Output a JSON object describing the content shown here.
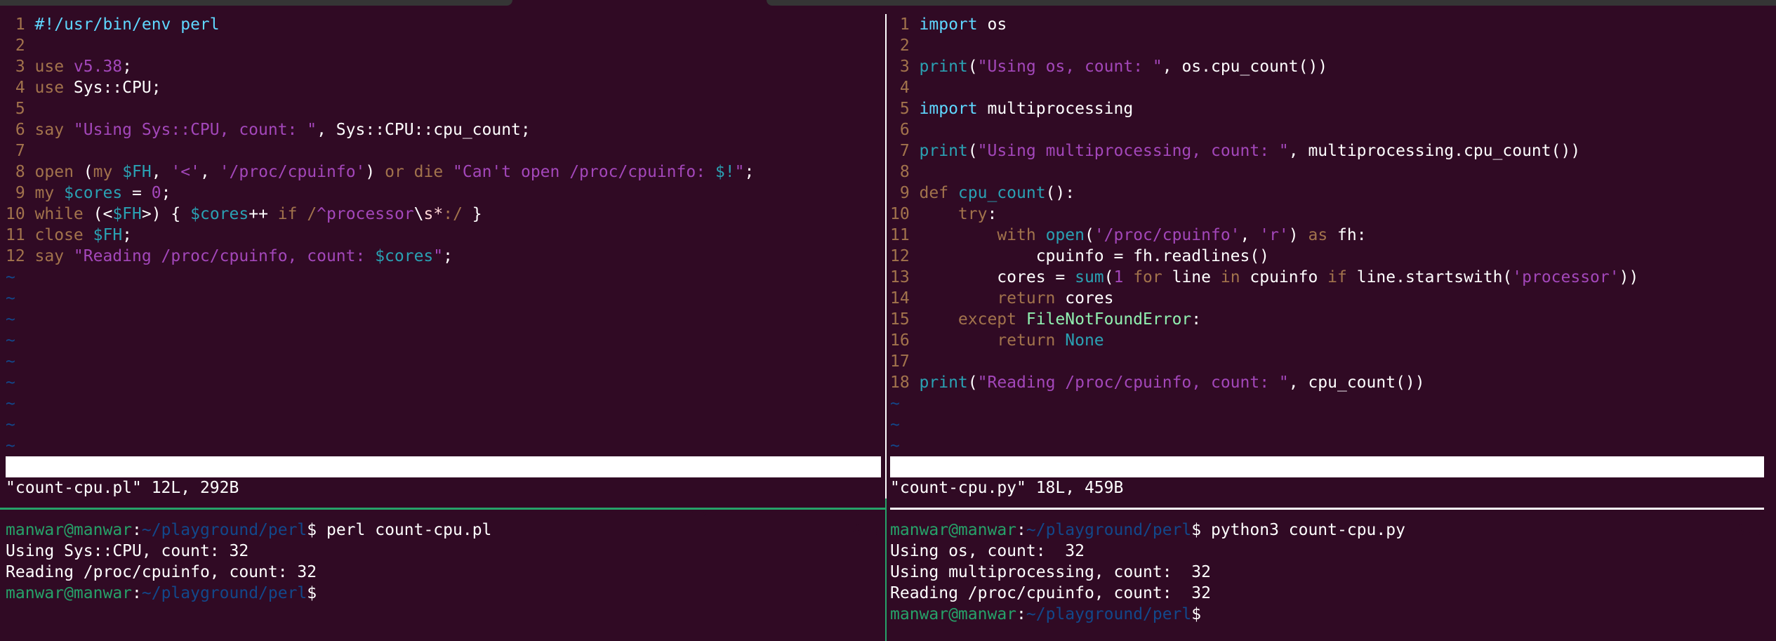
{
  "colors": {
    "background": "#300a24",
    "line_number": "#a2734c",
    "keyword": "#a2734c",
    "string": "#a347ba",
    "builtin": "#2aa1b3",
    "preproc": "#5fd7ff",
    "exception": "#90f0b0",
    "tilde": "#12488b",
    "prompt_user": "#26a269",
    "prompt_path": "#12488b"
  },
  "left_editor": {
    "filename": "count-cpu.pl",
    "cursor_pos": "1,1",
    "scroll": "All",
    "message": "\"count-cpu.pl\" 12L, 292B",
    "tilde_count": 9,
    "lines": [
      {
        "n": "1",
        "tokens": [
          {
            "t": "#!/usr/bin/env perl",
            "c": "cyan"
          }
        ]
      },
      {
        "n": "2",
        "tokens": []
      },
      {
        "n": "3",
        "tokens": [
          {
            "t": "use ",
            "c": "brown"
          },
          {
            "t": "v5.38",
            "c": "purple"
          },
          {
            "t": ";",
            "c": "white"
          }
        ]
      },
      {
        "n": "4",
        "tokens": [
          {
            "t": "use ",
            "c": "brown"
          },
          {
            "t": "Sys::CPU;",
            "c": "white"
          }
        ]
      },
      {
        "n": "5",
        "tokens": []
      },
      {
        "n": "6",
        "tokens": [
          {
            "t": "say ",
            "c": "brown"
          },
          {
            "t": "\"Using Sys::CPU, count: \"",
            "c": "purple"
          },
          {
            "t": ", Sys::CPU::cpu_count;",
            "c": "white"
          }
        ]
      },
      {
        "n": "7",
        "tokens": []
      },
      {
        "n": "8",
        "tokens": [
          {
            "t": "open ",
            "c": "brown"
          },
          {
            "t": "(",
            "c": "white"
          },
          {
            "t": "my ",
            "c": "brown"
          },
          {
            "t": "$FH",
            "c": "teal"
          },
          {
            "t": ", ",
            "c": "white"
          },
          {
            "t": "'<'",
            "c": "purple"
          },
          {
            "t": ", ",
            "c": "white"
          },
          {
            "t": "'/proc/cpuinfo'",
            "c": "purple"
          },
          {
            "t": ") ",
            "c": "white"
          },
          {
            "t": "or ",
            "c": "brown"
          },
          {
            "t": "die ",
            "c": "brown"
          },
          {
            "t": "\"Can't open /proc/cpuinfo: ",
            "c": "purple"
          },
          {
            "t": "$!",
            "c": "teal"
          },
          {
            "t": "\"",
            "c": "purple"
          },
          {
            "t": ";",
            "c": "white"
          }
        ]
      },
      {
        "n": "9",
        "tokens": [
          {
            "t": "my ",
            "c": "brown"
          },
          {
            "t": "$cores",
            "c": "teal"
          },
          {
            "t": " = ",
            "c": "white"
          },
          {
            "t": "0",
            "c": "purple"
          },
          {
            "t": ";",
            "c": "white"
          }
        ]
      },
      {
        "n": "10",
        "tokens": [
          {
            "t": "while ",
            "c": "brown"
          },
          {
            "t": "(<",
            "c": "white"
          },
          {
            "t": "$FH",
            "c": "teal"
          },
          {
            "t": ">) { ",
            "c": "white"
          },
          {
            "t": "$cores",
            "c": "teal"
          },
          {
            "t": "++ ",
            "c": "white"
          },
          {
            "t": "if ",
            "c": "brown"
          },
          {
            "t": "/",
            "c": "brown"
          },
          {
            "t": "^processor",
            "c": "purple"
          },
          {
            "t": "\\",
            "c": "white"
          },
          {
            "t": "s*",
            "c": "pink"
          },
          {
            "t": ":/",
            "c": "brown"
          },
          {
            "t": " }",
            "c": "white"
          }
        ]
      },
      {
        "n": "11",
        "tokens": [
          {
            "t": "close ",
            "c": "brown"
          },
          {
            "t": "$FH",
            "c": "teal"
          },
          {
            "t": ";",
            "c": "white"
          }
        ]
      },
      {
        "n": "12",
        "tokens": [
          {
            "t": "say ",
            "c": "brown"
          },
          {
            "t": "\"Reading /proc/cpuinfo, count: ",
            "c": "purple"
          },
          {
            "t": "$cores",
            "c": "teal"
          },
          {
            "t": "\"",
            "c": "purple"
          },
          {
            "t": ";",
            "c": "white"
          }
        ]
      }
    ]
  },
  "right_editor": {
    "filename": "count-cpu.py",
    "cursor_pos": "1,1",
    "scroll": "All",
    "message": "\"count-cpu.py\" 18L, 459B",
    "tilde_count": 3,
    "lines": [
      {
        "n": "1",
        "tokens": [
          {
            "t": "import ",
            "c": "cyan"
          },
          {
            "t": "os",
            "c": "white"
          }
        ]
      },
      {
        "n": "2",
        "tokens": []
      },
      {
        "n": "3",
        "tokens": [
          {
            "t": "print",
            "c": "teal"
          },
          {
            "t": "(",
            "c": "white"
          },
          {
            "t": "\"Using os, count: \"",
            "c": "purple"
          },
          {
            "t": ", os.cpu_count())",
            "c": "white"
          }
        ]
      },
      {
        "n": "4",
        "tokens": []
      },
      {
        "n": "5",
        "tokens": [
          {
            "t": "import ",
            "c": "cyan"
          },
          {
            "t": "multiprocessing",
            "c": "white"
          }
        ]
      },
      {
        "n": "6",
        "tokens": []
      },
      {
        "n": "7",
        "tokens": [
          {
            "t": "print",
            "c": "teal"
          },
          {
            "t": "(",
            "c": "white"
          },
          {
            "t": "\"Using multiprocessing, count: \"",
            "c": "purple"
          },
          {
            "t": ", multiprocessing.cpu_count())",
            "c": "white"
          }
        ]
      },
      {
        "n": "8",
        "tokens": []
      },
      {
        "n": "9",
        "tokens": [
          {
            "t": "def ",
            "c": "brown"
          },
          {
            "t": "cpu_count",
            "c": "teal"
          },
          {
            "t": "():",
            "c": "white"
          }
        ]
      },
      {
        "n": "10",
        "tokens": [
          {
            "t": "    ",
            "c": "white"
          },
          {
            "t": "try",
            "c": "brown"
          },
          {
            "t": ":",
            "c": "white"
          }
        ]
      },
      {
        "n": "11",
        "tokens": [
          {
            "t": "        ",
            "c": "white"
          },
          {
            "t": "with ",
            "c": "brown"
          },
          {
            "t": "open",
            "c": "teal"
          },
          {
            "t": "(",
            "c": "white"
          },
          {
            "t": "'/proc/cpuinfo'",
            "c": "purple"
          },
          {
            "t": ", ",
            "c": "white"
          },
          {
            "t": "'r'",
            "c": "purple"
          },
          {
            "t": ") ",
            "c": "white"
          },
          {
            "t": "as ",
            "c": "brown"
          },
          {
            "t": "fh:",
            "c": "white"
          }
        ]
      },
      {
        "n": "12",
        "tokens": [
          {
            "t": "            cpuinfo = fh.readlines()",
            "c": "white"
          }
        ]
      },
      {
        "n": "13",
        "tokens": [
          {
            "t": "        cores = ",
            "c": "white"
          },
          {
            "t": "sum",
            "c": "teal"
          },
          {
            "t": "(",
            "c": "white"
          },
          {
            "t": "1 ",
            "c": "purple"
          },
          {
            "t": "for ",
            "c": "brown"
          },
          {
            "t": "line ",
            "c": "white"
          },
          {
            "t": "in ",
            "c": "brown"
          },
          {
            "t": "cpuinfo ",
            "c": "white"
          },
          {
            "t": "if ",
            "c": "brown"
          },
          {
            "t": "line.startswith(",
            "c": "white"
          },
          {
            "t": "'processor'",
            "c": "purple"
          },
          {
            "t": "))",
            "c": "white"
          }
        ]
      },
      {
        "n": "14",
        "tokens": [
          {
            "t": "        ",
            "c": "white"
          },
          {
            "t": "return ",
            "c": "brown"
          },
          {
            "t": "cores",
            "c": "white"
          }
        ]
      },
      {
        "n": "15",
        "tokens": [
          {
            "t": "    ",
            "c": "white"
          },
          {
            "t": "except ",
            "c": "brown"
          },
          {
            "t": "FileNotFoundError",
            "c": "green"
          },
          {
            "t": ":",
            "c": "white"
          }
        ]
      },
      {
        "n": "16",
        "tokens": [
          {
            "t": "        ",
            "c": "white"
          },
          {
            "t": "return ",
            "c": "brown"
          },
          {
            "t": "None",
            "c": "teal"
          }
        ]
      },
      {
        "n": "17",
        "tokens": []
      },
      {
        "n": "18",
        "tokens": [
          {
            "t": "print",
            "c": "teal"
          },
          {
            "t": "(",
            "c": "white"
          },
          {
            "t": "\"Reading /proc/cpuinfo, count: \"",
            "c": "purple"
          },
          {
            "t": ", cpu_count())",
            "c": "white"
          }
        ]
      }
    ]
  },
  "left_terminal": {
    "prompt_user": "manwar@manwar",
    "prompt_path": "~/playground/perl",
    "lines": [
      {
        "type": "prompt",
        "command": "perl count-cpu.pl"
      },
      {
        "type": "output",
        "text": "Using Sys::CPU, count: 32"
      },
      {
        "type": "output",
        "text": "Reading /proc/cpuinfo, count: 32"
      },
      {
        "type": "prompt",
        "command": ""
      }
    ]
  },
  "right_terminal": {
    "prompt_user": "manwar@manwar",
    "prompt_path": "~/playground/perl",
    "lines": [
      {
        "type": "prompt",
        "command": "python3 count-cpu.py"
      },
      {
        "type": "output",
        "text": "Using os, count:  32"
      },
      {
        "type": "output",
        "text": "Using multiprocessing, count:  32"
      },
      {
        "type": "output",
        "text": "Reading /proc/cpuinfo, count:  32"
      },
      {
        "type": "prompt",
        "command": ""
      }
    ]
  }
}
